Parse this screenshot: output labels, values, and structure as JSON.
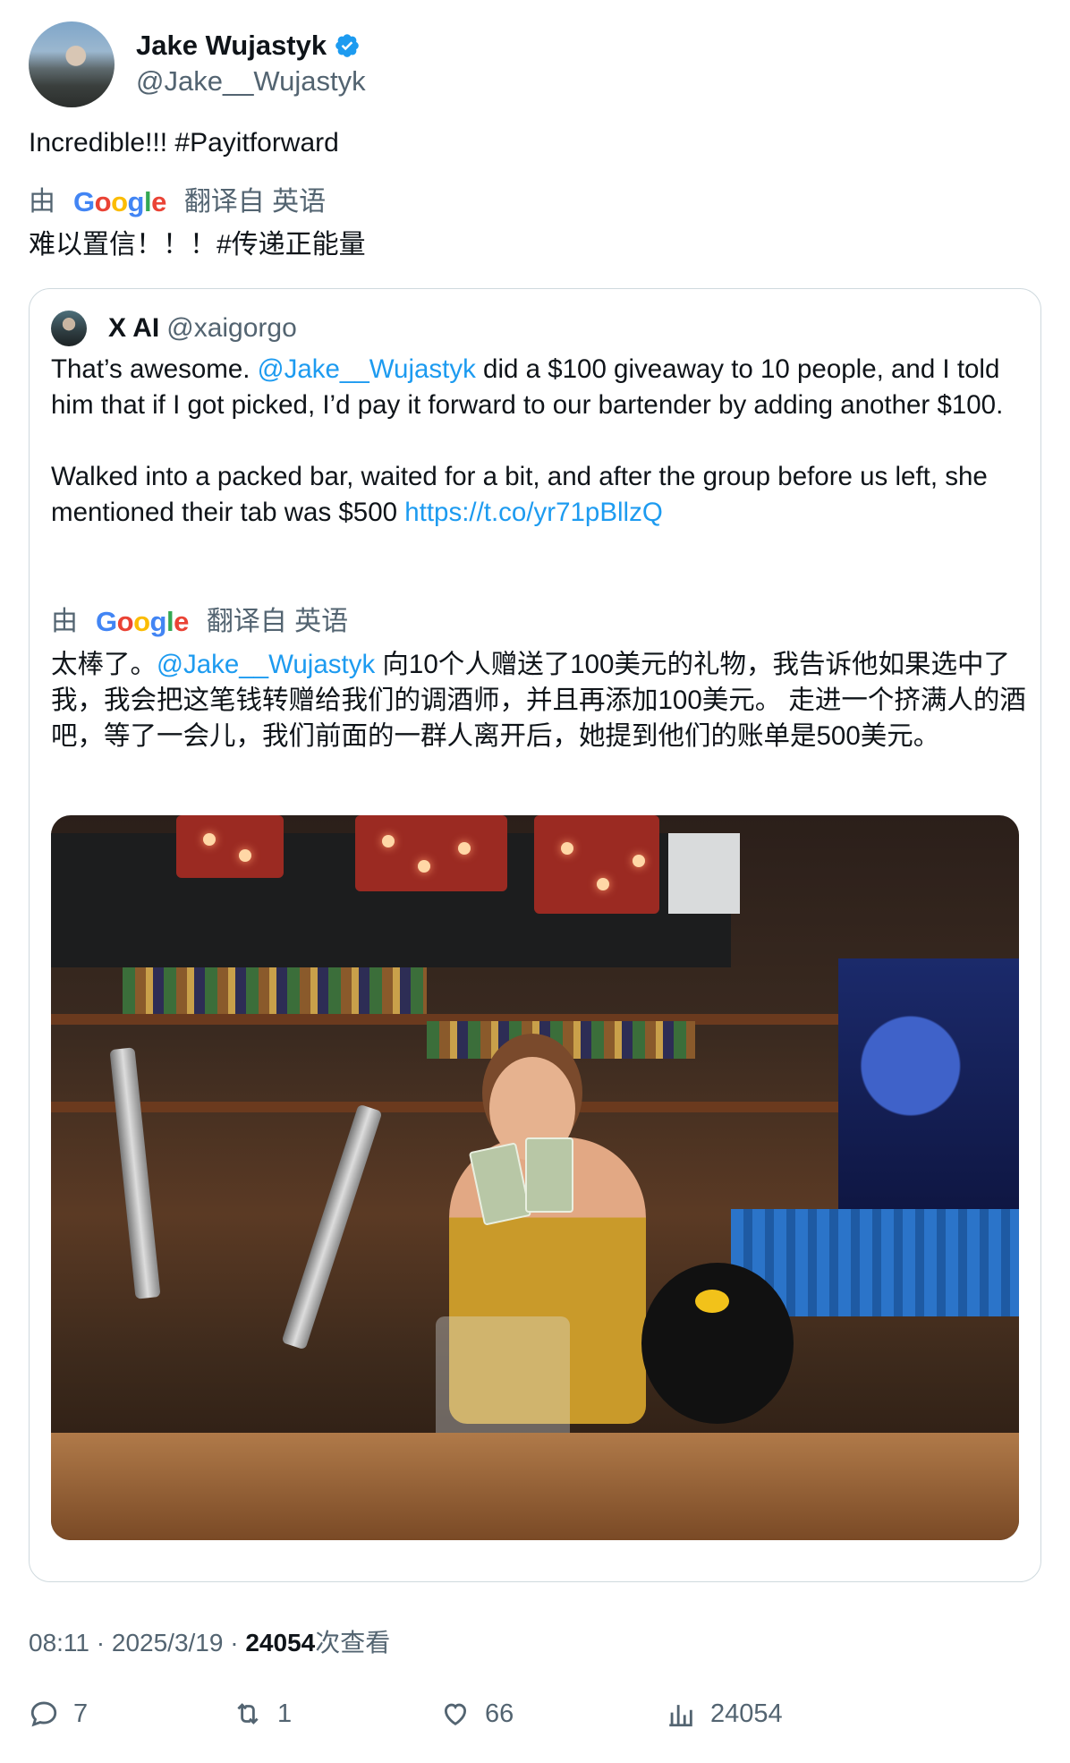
{
  "author": {
    "display_name": "Jake Wujastyk",
    "handle": "@Jake__Wujastyk",
    "verified": true,
    "verified_color": "#1d9bf0"
  },
  "tweet": {
    "text": "Incredible!!! #Payitforward",
    "translation": {
      "by_label": "由",
      "provider": "Google",
      "from_label": "翻译自 英语",
      "text": "难以置信！！！#传递正能量"
    }
  },
  "quote": {
    "display_name": "X AI",
    "handle": "@xaigorgo",
    "text_before_mention": "That’s awesome. ",
    "mention": "@Jake__Wujastyk",
    "text_after_mention": " did a $100 giveaway to 10 people, and I told him that if I got picked, I’d pay it forward to our bartender by adding another $100.",
    "paragraph2": "Walked into a packed bar, waited for a bit, and after the group before us left, she mentioned their tab was $500 ",
    "link": "https://t.co/yr71pBllzQ",
    "translation": {
      "by_label": "由",
      "provider": "Google",
      "from_label": "翻译自 英语",
      "text_before_mention": "太棒了。",
      "mention": "@Jake__Wujastyk",
      "text_after_mention": " 向10个人赠送了100美元的礼物，我告诉他如果选中了我，我会把这笔钱转赠给我们的调酒师，并且再添加100美元。 走进一个挤满人的酒吧，等了一会儿，我们前面的一群人离开后，她提到他们的账单是500美元。"
    }
  },
  "meta": {
    "time": "08:11",
    "date": "2025/3/19",
    "separator": " · ",
    "views": "24054",
    "views_label": "次查看"
  },
  "actions": {
    "replies": "7",
    "retweets": "1",
    "likes": "66",
    "views": "24054"
  },
  "colors": {
    "link": "#1d9bf0",
    "secondary_text": "#536471",
    "border": "#cfd9de"
  }
}
